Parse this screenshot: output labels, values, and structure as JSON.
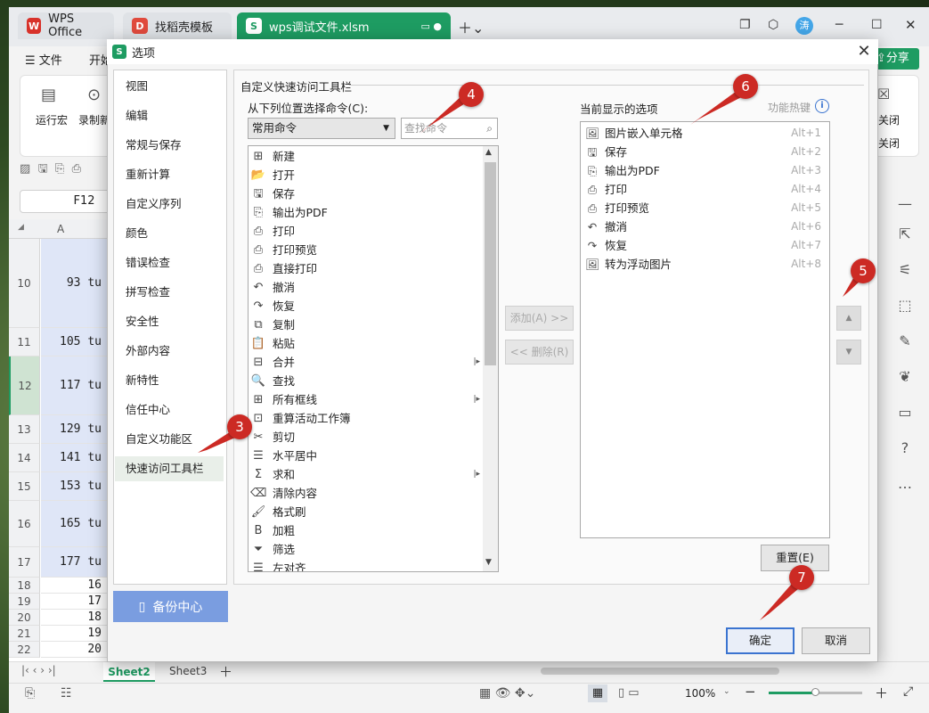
{
  "app": {
    "tabs": [
      {
        "label": "WPS Office"
      },
      {
        "label": "找稻壳模板"
      },
      {
        "label": "wps调试文件.xlsm"
      }
    ],
    "menu": {
      "file": "文件",
      "start": "开始",
      "share": "分享"
    },
    "ribbon": {
      "run_macro": "运行宏",
      "record": "录制新",
      "close1": "关闭",
      "close2": "关闭"
    },
    "namebox": "F12",
    "column_a": "A",
    "rows": [
      {
        "num": "10",
        "val": "93 tu"
      },
      {
        "num": "11",
        "val": "105 tu"
      },
      {
        "num": "12",
        "val": "117 tu"
      },
      {
        "num": "13",
        "val": "129 tu"
      },
      {
        "num": "14",
        "val": "141 tu"
      },
      {
        "num": "15",
        "val": "153 tu"
      },
      {
        "num": "16",
        "val": "165 tu"
      },
      {
        "num": "17",
        "val": "177 tu"
      },
      {
        "num": "18",
        "val": "16"
      },
      {
        "num": "19",
        "val": "17"
      },
      {
        "num": "20",
        "val": "18"
      },
      {
        "num": "21",
        "val": "19"
      },
      {
        "num": "22",
        "val": "20"
      }
    ],
    "sheets": [
      "Sheet2",
      "Sheet3"
    ],
    "zoom": "100%",
    "user_avatar": "涛"
  },
  "dialog": {
    "title": "选项",
    "nav": [
      "视图",
      "编辑",
      "常规与保存",
      "重新计算",
      "自定义序列",
      "颜色",
      "错误检查",
      "拼写检查",
      "安全性",
      "外部内容",
      "新特性",
      "信任中心",
      "自定义功能区",
      "快速访问工具栏"
    ],
    "nav_active": "快速访问工具栏",
    "backup": "备份中心",
    "group_title": "自定义快速访问工具栏",
    "choose_label": "从下列位置选择命令(C):",
    "choose_value": "常用命令",
    "search_placeholder": "查找命令",
    "commands": [
      {
        "label": "新建",
        "icon": "new-icon",
        "glyph": "⊞",
        "sub": false
      },
      {
        "label": "打开",
        "icon": "open-folder-icon",
        "glyph": "📂",
        "sub": false
      },
      {
        "label": "保存",
        "icon": "save-icon",
        "glyph": "🖫",
        "sub": false
      },
      {
        "label": "输出为PDF",
        "icon": "pdf-icon",
        "glyph": "⎘",
        "sub": false
      },
      {
        "label": "打印",
        "icon": "print-icon",
        "glyph": "⎙",
        "sub": false
      },
      {
        "label": "打印预览",
        "icon": "print-preview-icon",
        "glyph": "⎙",
        "sub": false
      },
      {
        "label": "直接打印",
        "icon": "direct-print-icon",
        "glyph": "⎙",
        "sub": false
      },
      {
        "label": "撤消",
        "icon": "undo-icon",
        "glyph": "↶",
        "sub": false
      },
      {
        "label": "恢复",
        "icon": "redo-icon",
        "glyph": "↷",
        "sub": false
      },
      {
        "label": "复制",
        "icon": "copy-icon",
        "glyph": "⧉",
        "sub": false
      },
      {
        "label": "粘贴",
        "icon": "paste-icon",
        "glyph": "📋",
        "sub": false
      },
      {
        "label": "合并",
        "icon": "merge-icon",
        "glyph": "⊟",
        "sub": true
      },
      {
        "label": "查找",
        "icon": "find-icon",
        "glyph": "🔍",
        "sub": false
      },
      {
        "label": "所有框线",
        "icon": "borders-icon",
        "glyph": "⊞",
        "sub": true
      },
      {
        "label": "重算活动工作簿",
        "icon": "recalc-icon",
        "glyph": "⊡",
        "sub": false
      },
      {
        "label": "剪切",
        "icon": "cut-icon",
        "glyph": "✂",
        "sub": false
      },
      {
        "label": "水平居中",
        "icon": "center-align-icon",
        "glyph": "☰",
        "sub": false
      },
      {
        "label": "求和",
        "icon": "sum-icon",
        "glyph": "Σ",
        "sub": true
      },
      {
        "label": "清除内容",
        "icon": "clear-icon",
        "glyph": "⌫",
        "sub": false
      },
      {
        "label": "格式刷",
        "icon": "format-painter-icon",
        "glyph": "🖌",
        "sub": false
      },
      {
        "label": "加粗",
        "icon": "bold-icon",
        "glyph": "B",
        "sub": false
      },
      {
        "label": "筛选",
        "icon": "filter-icon",
        "glyph": "⏷",
        "sub": false
      },
      {
        "label": "左对齐",
        "icon": "left-align-icon",
        "glyph": "☰",
        "sub": false
      }
    ],
    "add_btn": "添加(A) >>",
    "remove_btn": "<< 删除(R)",
    "current_label": "当前显示的选项",
    "hotkey_label": "功能热键",
    "current": [
      {
        "label": "图片嵌入单元格",
        "key": "Alt+1",
        "icon": "image-cell-icon",
        "glyph": "🖼"
      },
      {
        "label": "保存",
        "key": "Alt+2",
        "icon": "save-icon",
        "glyph": "🖫"
      },
      {
        "label": "输出为PDF",
        "key": "Alt+3",
        "icon": "pdf-icon",
        "glyph": "⎘"
      },
      {
        "label": "打印",
        "key": "Alt+4",
        "icon": "print-icon",
        "glyph": "⎙"
      },
      {
        "label": "打印预览",
        "key": "Alt+5",
        "icon": "print-preview-icon",
        "glyph": "⎙"
      },
      {
        "label": "撤消",
        "key": "Alt+6",
        "icon": "undo-icon",
        "glyph": "↶"
      },
      {
        "label": "恢复",
        "key": "Alt+7",
        "icon": "redo-icon",
        "glyph": "↷"
      },
      {
        "label": "转为浮动图片",
        "key": "Alt+8",
        "icon": "float-image-icon",
        "glyph": "🖼"
      }
    ],
    "reset_btn": "重置(E)",
    "ok_btn": "确定",
    "cancel_btn": "取消",
    "badges": [
      "3",
      "4",
      "5",
      "6",
      "7"
    ]
  }
}
